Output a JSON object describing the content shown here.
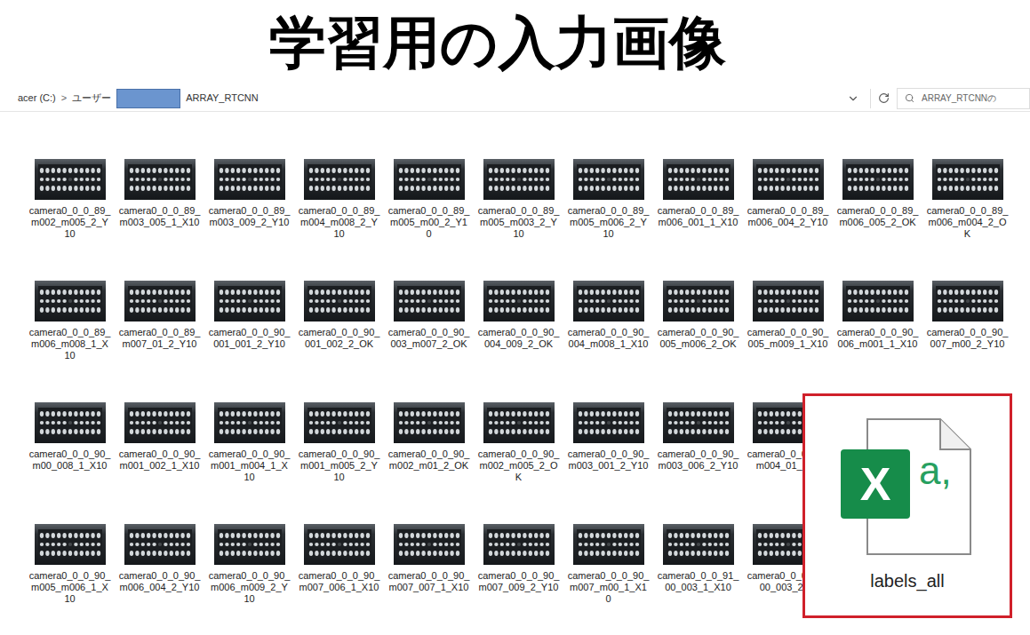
{
  "title": "学習用の入力画像",
  "address_bar": {
    "separator": ">",
    "segments": [
      {
        "label": "acer (C:)",
        "redacted": false,
        "separated": false
      },
      {
        "label": "ユーザー",
        "redacted": false,
        "separated": true
      },
      {
        "label": "",
        "redacted": true,
        "separated": false
      },
      {
        "label": "ARRAY_RTCNN",
        "redacted": false,
        "separated": false
      }
    ]
  },
  "search": {
    "placeholder": "ARRAY_RTCNNの"
  },
  "file_rows": [
    [
      "camera0_0_0_89_m002_m005_2_Y10",
      "camera0_0_0_89_m003_005_1_X10",
      "camera0_0_0_89_m003_009_2_Y10",
      "camera0_0_0_89_m004_m008_2_Y10",
      "camera0_0_0_89_m005_m00_2_Y10",
      "camera0_0_0_89_m005_m003_2_Y10",
      "camera0_0_0_89_m005_m006_2_Y10",
      "camera0_0_0_89_m006_001_1_X10",
      "camera0_0_0_89_m006_004_2_Y10",
      "camera0_0_0_89_m006_005_2_OK",
      "camera0_0_0_89_m006_m004_2_OK"
    ],
    [
      "camera0_0_0_89_m006_m008_1_X10",
      "camera0_0_0_89_m007_01_2_Y10",
      "camera0_0_0_90_001_001_2_Y10",
      "camera0_0_0_90_001_002_2_OK",
      "camera0_0_0_90_003_m007_2_OK",
      "camera0_0_0_90_004_009_2_OK",
      "camera0_0_0_90_004_m008_1_X10",
      "camera0_0_0_90_005_m006_2_OK",
      "camera0_0_0_90_005_m009_1_X10",
      "camera0_0_0_90_006_m001_1_X10",
      "camera0_0_0_90_007_m00_2_Y10"
    ],
    [
      "camera0_0_0_90_m00_008_1_X10",
      "camera0_0_0_90_m001_002_1_X10",
      "camera0_0_0_90_m001_m004_1_X10",
      "camera0_0_0_90_m001_m005_2_Y10",
      "camera0_0_0_90_m002_m01_2_OK",
      "camera0_0_0_90_m002_m005_2_OK",
      "camera0_0_0_90_m003_001_2_Y10",
      "camera0_0_0_90_m003_006_2_Y10",
      "camera0_0_0_90_m004_01_2_Y"
    ],
    [
      "camera0_0_0_90_m005_m006_1_X10",
      "camera0_0_0_90_m006_004_2_Y10",
      "camera0_0_0_90_m006_m009_2_Y10",
      "camera0_0_0_90_m007_006_1_X10",
      "camera0_0_0_90_m007_007_1_X10",
      "camera0_0_0_90_m007_009_2_Y10",
      "camera0_0_0_90_m007_m00_1_X10",
      "camera0_0_0_91_00_003_1_X10",
      "camera0_0_0_91_00_003_2_O"
    ]
  ],
  "highlight": {
    "icon_letter": "X",
    "icon_glyph": "a,",
    "label": "labels_all"
  }
}
